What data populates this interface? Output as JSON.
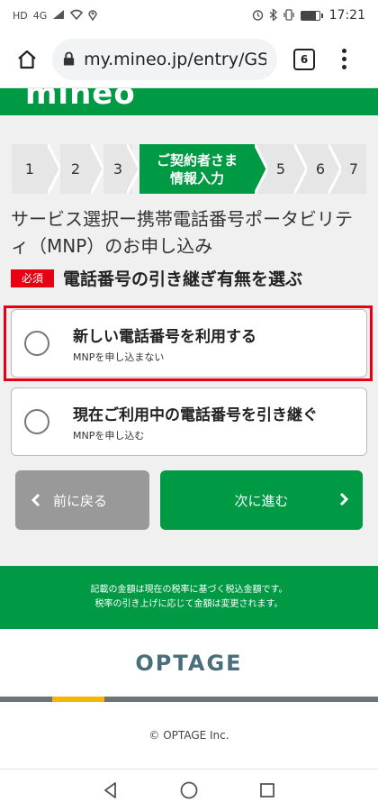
{
  "status_bar": {
    "left_icons": [
      "HD",
      "4G",
      "signal-icon",
      "wifi-icon",
      "location-icon"
    ],
    "time": "17:21",
    "right_icons": [
      "alarm-icon",
      "bluetooth-icon",
      "vibrate-icon",
      "battery-icon"
    ]
  },
  "browser": {
    "url": "my.mineo.jp/entry/GSK",
    "tab_count": "6"
  },
  "site": {
    "logo": "mineo"
  },
  "steps": [
    {
      "label": "1"
    },
    {
      "label": "2"
    },
    {
      "label": "3"
    },
    {
      "label_line1": "ご契約者さま",
      "label_line2": "情報入力"
    },
    {
      "label": "5"
    },
    {
      "label": "6"
    },
    {
      "label": "7"
    }
  ],
  "section": {
    "title": "サービス選択ー携帯電話番号ポータビリティ（MNP）のお申し込み",
    "required_badge": "必須",
    "question": "電話番号の引き継ぎ有無を選ぶ"
  },
  "options": [
    {
      "main": "新しい電話番号を利用する",
      "sub": "MNPを申し込まない"
    },
    {
      "main": "現在ご利用中の電話番号を引き継ぐ",
      "sub": "MNPを申し込む"
    }
  ],
  "buttons": {
    "back": "前に戻る",
    "next": "次に進む"
  },
  "footer": {
    "note_line1": "記載の金額は現在の税率に基づく税込金額です。",
    "note_line2": "税率の引き上げに応じて金額は変更されます。",
    "brand": "OPTAGE",
    "copyright": "© OPTAGE Inc."
  },
  "colors": {
    "brand_green": "#009944",
    "required_red": "#e60012",
    "back_gray": "#999999"
  }
}
